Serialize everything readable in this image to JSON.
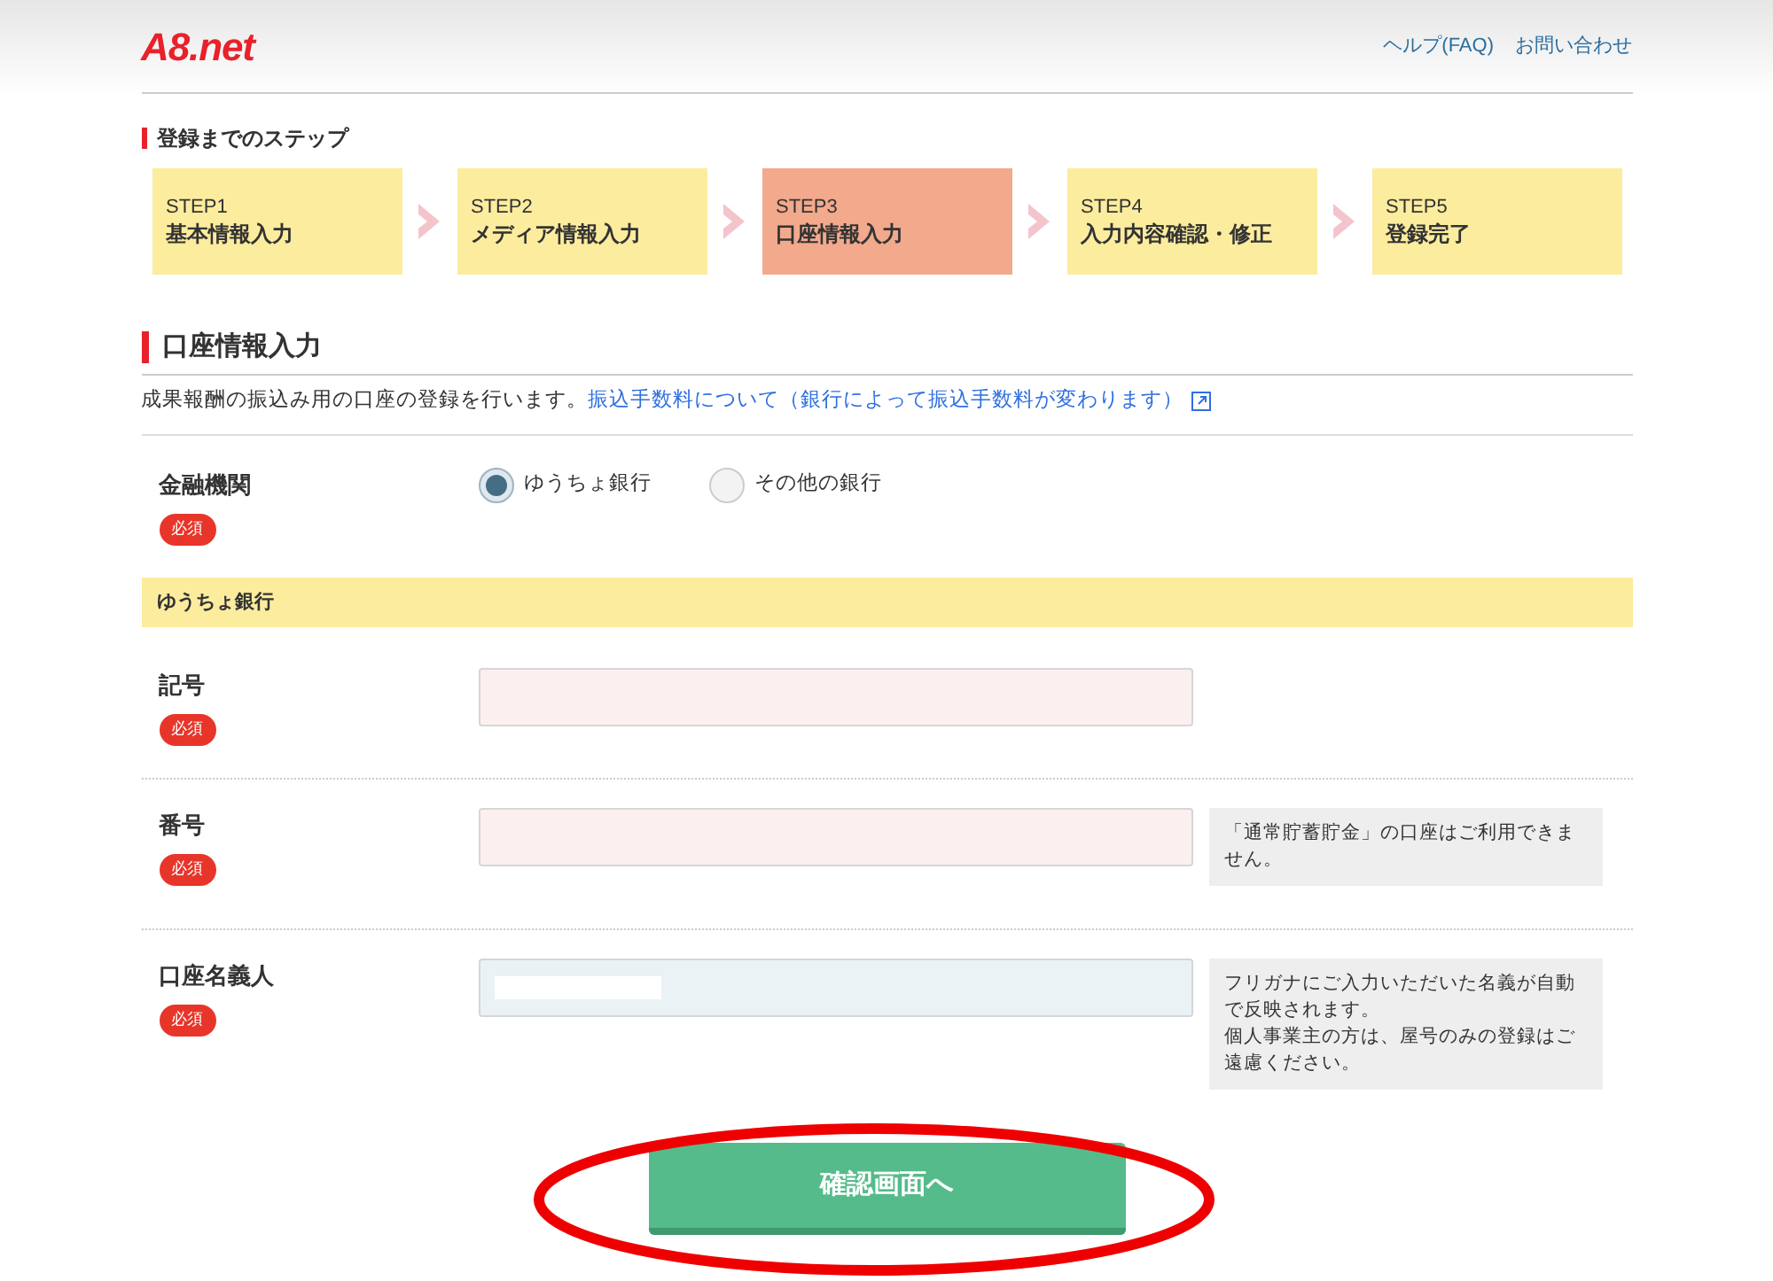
{
  "header": {
    "logo": "A8.net",
    "links": [
      "ヘルプ(FAQ)",
      "お問い合わせ"
    ]
  },
  "steps_title": "登録までのステップ",
  "steps": [
    {
      "label": "STEP1",
      "title": "基本情報入力",
      "selected": false
    },
    {
      "label": "STEP2",
      "title": "メディア情報入力",
      "selected": false
    },
    {
      "label": "STEP3",
      "title": "口座情報入力",
      "selected": true
    },
    {
      "label": "STEP4",
      "title": "入力内容確認・修正",
      "selected": false
    },
    {
      "label": "STEP5",
      "title": "登録完了",
      "selected": false
    }
  ],
  "section": {
    "title": "口座情報入力",
    "intro": "成果報酬の振込み用の口座の登録を行います。",
    "link": "振込手数料について（銀行によって振込手数料が変わります）"
  },
  "bank": {
    "label": "金融機関",
    "required": "必須",
    "options": [
      {
        "label": "ゆうちょ銀行",
        "selected": true
      },
      {
        "label": "その他の銀行",
        "selected": false
      }
    ]
  },
  "subheader": "ゆうちょ銀行",
  "fields": [
    {
      "label": "記号",
      "required": "必須",
      "kind": "pink"
    },
    {
      "label": "番号",
      "required": "必須",
      "kind": "pink",
      "note": [
        "「通常貯蓄貯金」の口座はご利用できません。"
      ]
    },
    {
      "label": "口座名義人",
      "required": "必須",
      "kind": "filled",
      "note": [
        "フリガナにご入力いただいた名義が自動で反映されます。",
        "個人事業主の方は、屋号のみの登録はご遠慮ください。"
      ]
    }
  ],
  "submit": "確認画面へ"
}
